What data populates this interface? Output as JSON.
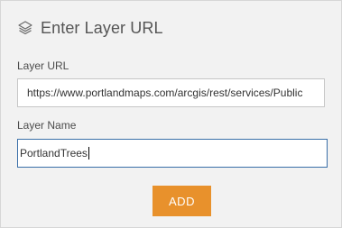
{
  "header": {
    "icon": "layers-icon",
    "title": "Enter Layer URL"
  },
  "form": {
    "url_label": "Layer URL",
    "url_value": "https://www.portlandmaps.com/arcgis/rest/services/Public",
    "name_label": "Layer Name",
    "name_value": "PortlandTrees"
  },
  "actions": {
    "add_label": "ADD"
  },
  "colors": {
    "panel_bg": "#f2f2f2",
    "accent_button": "#e8912c",
    "focus_border": "#3a6fa8"
  }
}
